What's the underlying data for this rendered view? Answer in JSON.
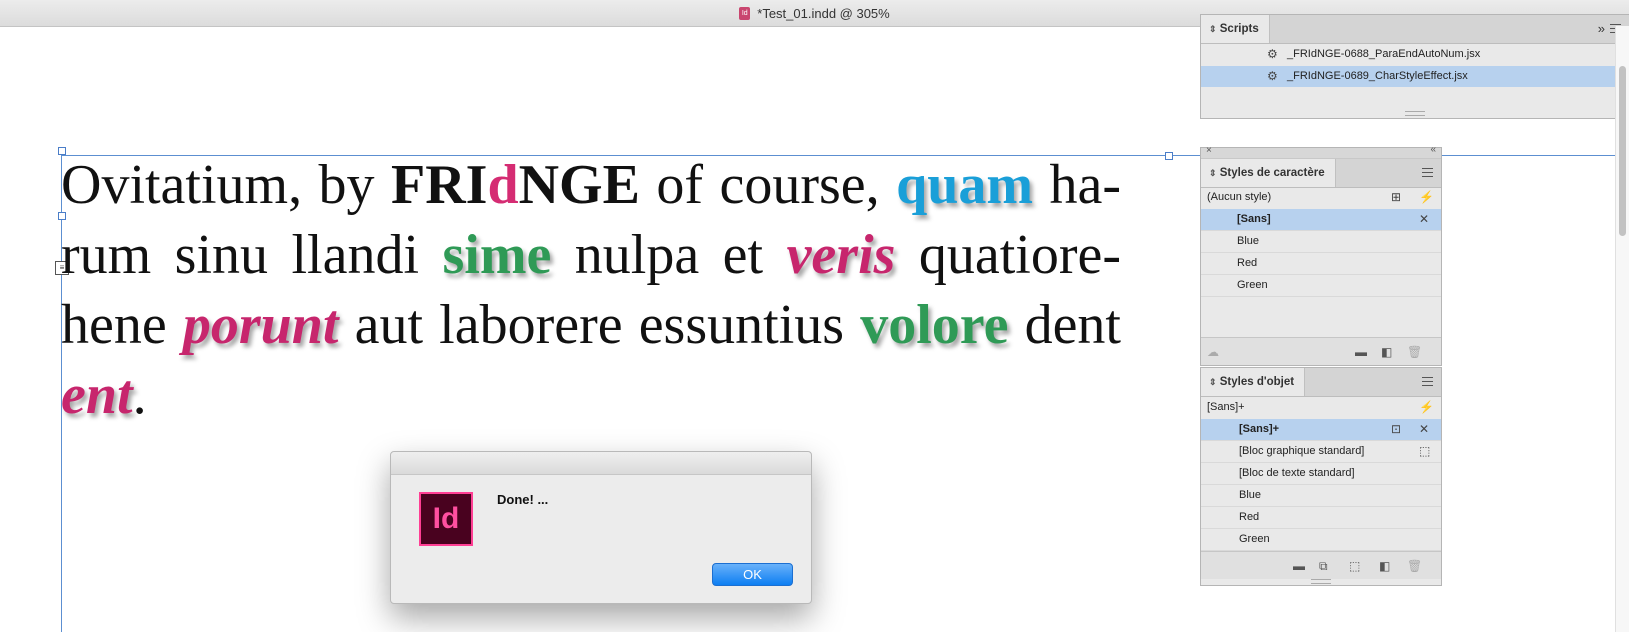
{
  "window": {
    "title": "*Test_01.indd @ 305%",
    "doc_icon": "Id"
  },
  "document_text": {
    "p1": "Ovitatium, by ",
    "brand_a": "FRI",
    "brand_d": "d",
    "brand_b": "NGE",
    "p2": " of course, ",
    "w_quam": "quam",
    "p3": " ha-rum sinu llandi ",
    "w_sime": "sime",
    "p4": " nulpa et ",
    "w_veris": "veris",
    "p5": " quatiore-hene ",
    "w_porunt": "porunt",
    "p6": " aut laborere essuntius ",
    "w_volore": "volore",
    "p7": " dent ",
    "w_ent": "ent",
    "p8": "."
  },
  "dialog": {
    "app_logo": "Id",
    "message": "Done! ...",
    "ok_label": "OK"
  },
  "scripts_panel": {
    "tab": "Scripts",
    "items": [
      {
        "label": "_FRIdNGE-0688_ParaEndAutoNum.jsx",
        "selected": false
      },
      {
        "label": "_FRIdNGE-0689_CharStyleEffect.jsx",
        "selected": true
      }
    ]
  },
  "char_styles_panel": {
    "tab": "Styles de caractère",
    "current": "(Aucun style)",
    "items": [
      {
        "label": "[Sans]",
        "selected": true
      },
      {
        "label": "Blue",
        "selected": false
      },
      {
        "label": "Red",
        "selected": false
      },
      {
        "label": "Green",
        "selected": false
      }
    ]
  },
  "object_styles_panel": {
    "tab": "Styles d'objet",
    "current": "[Sans]+",
    "items": [
      {
        "label": "[Sans]+",
        "selected": true
      },
      {
        "label": "[Bloc graphique standard]",
        "selected": false
      },
      {
        "label": "[Bloc de texte standard]",
        "selected": false
      },
      {
        "label": "Blue",
        "selected": false
      },
      {
        "label": "Red",
        "selected": false
      },
      {
        "label": "Green",
        "selected": false
      }
    ]
  },
  "colors": {
    "blue": "#1a9fd8",
    "green": "#2f9a56",
    "red": "#c7266d",
    "brand_pink": "#d52c73",
    "selection": "#b7d1ee"
  }
}
